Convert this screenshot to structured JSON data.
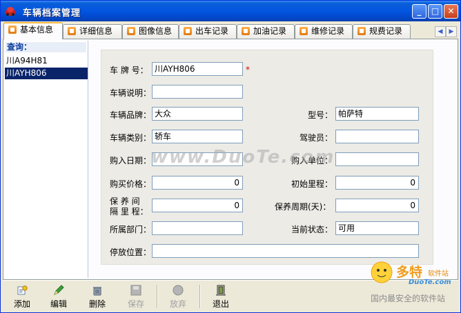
{
  "window": {
    "title": "车辆档案管理",
    "minimize": "_",
    "maximize": "□",
    "close": "✕"
  },
  "tabs": [
    {
      "label": "基本信息",
      "active": true
    },
    {
      "label": "详细信息",
      "active": false
    },
    {
      "label": "图像信息",
      "active": false
    },
    {
      "label": "出车记录",
      "active": false
    },
    {
      "label": "加油记录",
      "active": false
    },
    {
      "label": "维修记录",
      "active": false
    },
    {
      "label": "规费记录",
      "active": false
    }
  ],
  "tab_scroll": {
    "left": "◀",
    "right": "▶"
  },
  "left_panel": {
    "search_label": "查询：",
    "plates": [
      "川A94H81",
      "川AYH806"
    ],
    "selected_plate": "川AYH806"
  },
  "form": {
    "plate_label": "车 牌 号：",
    "plate": "川AYH806",
    "required_mark": "*",
    "desc_label": "车辆说明：",
    "desc": "",
    "brand_label": "车辆品牌：",
    "brand": "大众",
    "model_label": "型号：",
    "model": "帕萨特",
    "type_label": "车辆类别：",
    "type": "轿车",
    "driver_label": "驾驶员：",
    "driver": "",
    "buy_date_label": "购入日期：",
    "buy_date": "",
    "buy_unit_label": "购入单位：",
    "buy_unit": "",
    "price_label": "购买价格：",
    "price": "0",
    "init_mileage_label": "初始里程：",
    "init_mileage": "0",
    "maint_interval_label_1": "保 养 间",
    "maint_interval_label_2": "隔 里 程：",
    "maint_interval": "0",
    "maint_period_label": "保养周期(天)：",
    "maint_period": "0",
    "dept_label": "所属部门：",
    "dept": "",
    "status_label": "当前状态：",
    "status": "可用",
    "parking_label": "停放位置：",
    "parking": ""
  },
  "watermark": "www.DuoTe.com",
  "toolbar": {
    "add": "添加",
    "edit": "编辑",
    "delete": "删除",
    "save": "保存",
    "discard": "放弃",
    "exit": "退出"
  },
  "site_logo": {
    "name": "多特",
    "small": "软件站",
    "domain": "DuoTe.com",
    "tagline": "国内最安全的软件站"
  },
  "colors": {
    "title_blue": "#0355e0",
    "selected": "#0a246a",
    "tab_active_accent": "#f6b840",
    "required": "#dd0000"
  },
  "icons": {
    "app": "car-icon",
    "tab": "tab-doc-icon",
    "add": "add-record-icon",
    "edit": "pencil-icon",
    "delete": "trash-icon",
    "save": "floppy-icon",
    "discard": "discard-icon",
    "exit": "door-exit-icon"
  }
}
